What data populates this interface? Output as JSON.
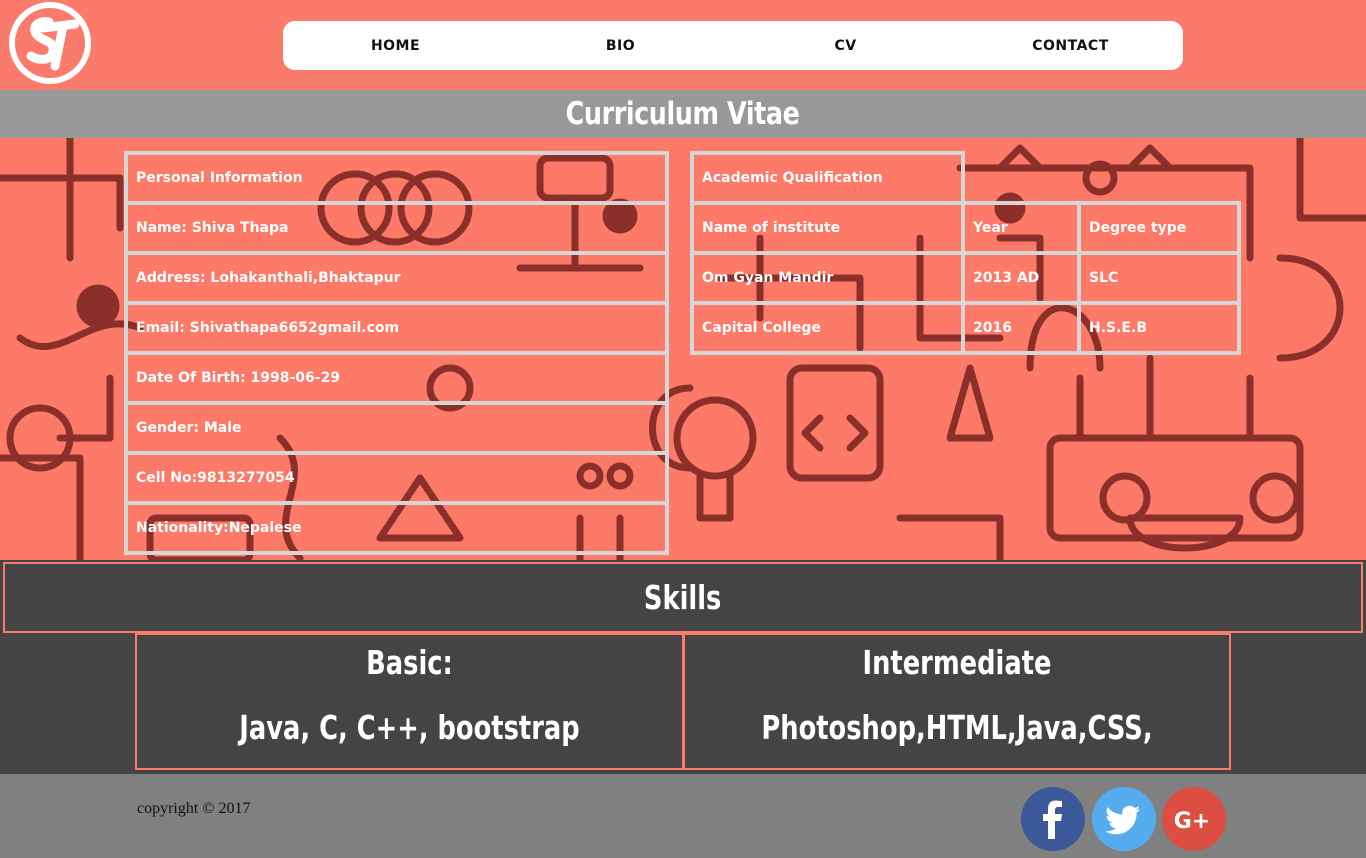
{
  "header": {
    "logo_text": "ST",
    "nav": [
      {
        "label": "HOME"
      },
      {
        "label": "BIO"
      },
      {
        "label": "CV"
      },
      {
        "label": "CONTACT"
      }
    ]
  },
  "page_title": "Curriculum Vitae",
  "personal": {
    "heading": "Personal Information",
    "rows": [
      "Name: Shiva Thapa",
      "Address: Lohakanthali,Bhaktapur",
      "Email: Shivathapa6652gmail.com",
      "Date Of Birth: 1998-06-29",
      "Gender: Male",
      "Cell No:9813277054",
      "Nationality:Nepalese"
    ]
  },
  "academic": {
    "heading": "Academic Qualification",
    "columns": [
      "Name of institute",
      "Year",
      "Degree type"
    ],
    "rows": [
      [
        "Om Gyan Mandir",
        "2013 AD",
        "SLC"
      ],
      [
        "Capital College",
        "2016",
        "H.S.E.B"
      ]
    ]
  },
  "skills": {
    "heading": "Skills",
    "basic": {
      "title": "Basic:",
      "body": "Java, C, C++, bootstrap"
    },
    "intermediate": {
      "title": "Intermediate",
      "body": "Photoshop,HTML,Java,CSS,"
    }
  },
  "footer": {
    "copyright": "copyright © 2017",
    "social": [
      {
        "icon": "facebook-icon",
        "color": "#3b5998"
      },
      {
        "icon": "twitter-icon",
        "color": "#55acee"
      },
      {
        "icon": "google-plus-icon",
        "color": "#dc4e41"
      }
    ]
  },
  "colors": {
    "brand": "#fa7b6b",
    "title_band": "#999999",
    "skills_bg": "#444444",
    "footer_bg": "#808080"
  }
}
